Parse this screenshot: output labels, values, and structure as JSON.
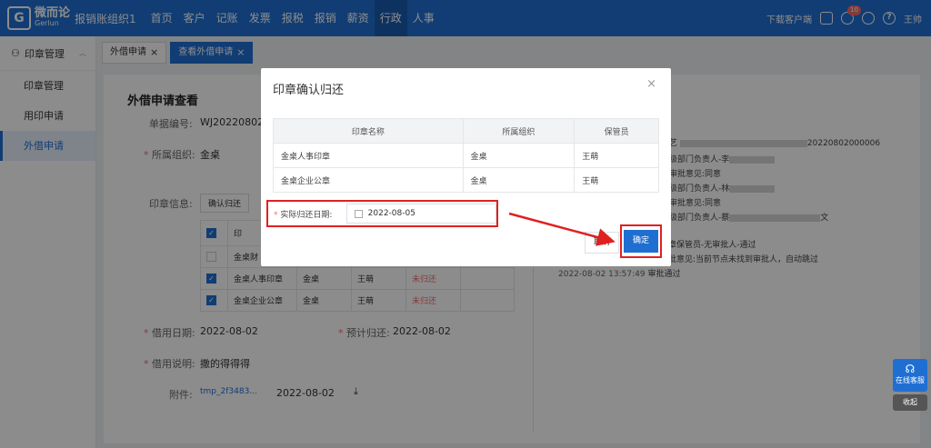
{
  "brand": {
    "name": "微而论",
    "en": "Gerlun"
  },
  "company": "报销账组织1",
  "nav": [
    "首页",
    "客户",
    "记账",
    "发票",
    "报税",
    "报销",
    "薪资",
    "行政",
    "人事"
  ],
  "top_right": {
    "download": "下载客户端",
    "badge": "10",
    "user": "王帅"
  },
  "sidebar": {
    "group": "印章管理",
    "items": [
      "印章管理",
      "用印申请",
      "外借申请"
    ]
  },
  "tabs": [
    "外借申请",
    "查看外借申请"
  ],
  "page": {
    "title": "外借申请查看",
    "doc_no_label": "单据编号:",
    "doc_no": "WJ2022080200",
    "org_label": "所属组织:",
    "org": "金桌",
    "seal_info_label": "印章信息:",
    "confirm_return_btn": "确认归还",
    "table_header_seal": "印",
    "rows": [
      {
        "seal": "金桌财",
        "org": "",
        "keeper": "",
        "status": ""
      },
      {
        "seal": "金桌人事印章",
        "org": "金桌",
        "keeper": "王萌",
        "status": "未归还"
      },
      {
        "seal": "金桌企业公章",
        "org": "金桌",
        "keeper": "王萌",
        "status": "未归还"
      }
    ],
    "borrow_date_label": "借用日期:",
    "borrow_date": "2022-08-02",
    "expected_return_label": "预计归还:",
    "expected_return": "2022-08-02",
    "desc_label": "借用说明:",
    "desc": "撒的得得得",
    "attach_label": "附件:",
    "attach_name": "tmp_2f3483...",
    "attach_date": "2022-08-02"
  },
  "timeline": [
    {
      "text": "艺",
      "tail": "20220802000006"
    },
    {
      "text": "级部门负责人-李",
      "tail": ""
    },
    {
      "text": "审批意见:同意",
      "tail": ""
    },
    {
      "text": "级部门负责人-林",
      "tail": ""
    },
    {
      "text": "审批意见:同意",
      "tail": ""
    },
    {
      "text": "级部门负责人-蔡",
      "tail": "文"
    },
    {
      "text": "印章保管员-无审批人-通过",
      "tail": ""
    },
    {
      "text": "审批意见:当前节点未找到审批人，自动跳过",
      "tail": ""
    },
    {
      "text": "审批通过",
      "time": "2022-08-02 13:57:49"
    }
  ],
  "modal": {
    "title": "印章确认归还",
    "headers": [
      "印章名称",
      "所属组织",
      "保管员"
    ],
    "rows": [
      [
        "金桌人事印章",
        "金桌",
        "王萌"
      ],
      [
        "金桌企业公章",
        "金桌",
        "王萌"
      ]
    ],
    "date_label": "实际归还日期:",
    "date_value": "2022-08-05",
    "cancel": "取消",
    "ok": "确定"
  },
  "float": {
    "service": "在线客服",
    "collapse": "收起"
  },
  "colors": {
    "primary": "#1f6fd3",
    "danger": "#f56c6c",
    "highlight": "#e02020"
  }
}
